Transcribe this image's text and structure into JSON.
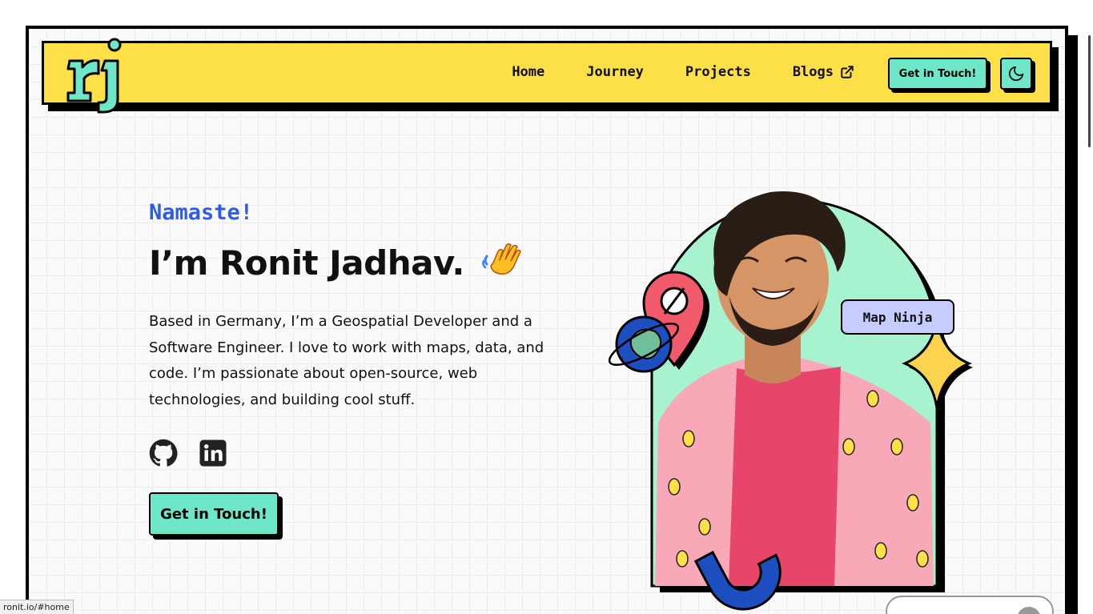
{
  "header": {
    "logo_alt": "rj",
    "nav": [
      {
        "label": "Home"
      },
      {
        "label": "Journey"
      },
      {
        "label": "Projects"
      },
      {
        "label": "Blogs"
      }
    ],
    "cta_label": "Get in Touch!",
    "theme_toggle_icon": "moon-icon"
  },
  "hero": {
    "greeting": "Namaste!",
    "name": "I’m Ronit Jadhav.",
    "bio": "Based in Germany, I’m a Geospatial Developer and a Software Engineer. I love to work with maps, data, and code. I’m passionate about open-source, web technologies, and building cool stuff.",
    "socials": [
      {
        "icon": "github-icon"
      },
      {
        "icon": "linkedin-icon"
      }
    ],
    "cta_label": "Get in Touch!",
    "badge": "Map Ninja"
  },
  "status_bar": {
    "url": "ronit.io/#home"
  },
  "colors": {
    "nav_bg": "#fde047",
    "accent": "#6ee7c8",
    "greeting": "#2f5be8",
    "badge_bg": "#c7ccff"
  }
}
